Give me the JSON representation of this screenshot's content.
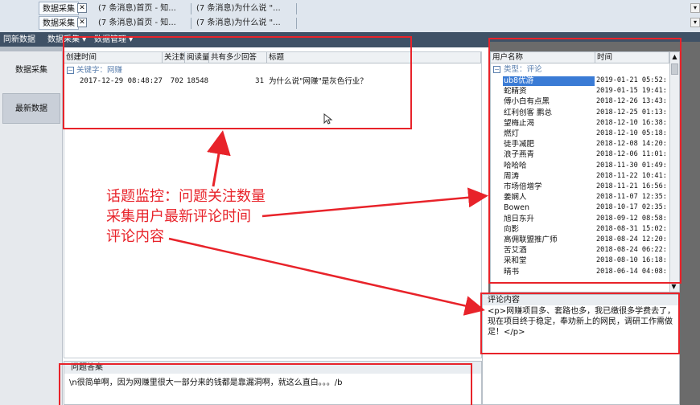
{
  "tabs": {
    "row1": {
      "active": "数据采集",
      "t1": "(7 条消息)首页 - 知...",
      "t2": "(7 条消息)为什么说 \"..."
    },
    "row2": {
      "active": "数据采集",
      "t1": "(7 条消息)首页 - 知...",
      "t2": "(7 条消息)为什么说 \"..."
    }
  },
  "menubar": {
    "item1": "同新数据",
    "item2": "数据采集 ▾",
    "item3": "数据管理 ▾"
  },
  "leftnav": {
    "btn1": "数据采集",
    "btn2": "最新数据"
  },
  "grid": {
    "headers": [
      "创建时间",
      "关注数",
      "阅读量",
      "共有多少回答",
      "标题"
    ],
    "group": "关键字：网赚",
    "rows": [
      {
        "created": "2017-12-29 08:48:27",
        "follow": "702",
        "read": "18548",
        "answers": "31",
        "title": "为什么说\"网赚\"是灰色行业？"
      }
    ]
  },
  "answer": {
    "title": "问题答案",
    "text": "\\n很简单啊，因为网赚里很大一部分来的钱都是靠漏洞啊，就这么直白。。。/b"
  },
  "userlist": {
    "headers": [
      "用户名称",
      "时间"
    ],
    "group": "类型：评论",
    "rows": [
      {
        "name": "ub8优游",
        "time": "2019-01-21 05:52:"
      },
      {
        "name": "蛇精资",
        "time": "2019-01-15 19:41:"
      },
      {
        "name": "傅小白有点黑",
        "time": "2018-12-26 13:43:"
      },
      {
        "name": "红利创客 鹏总",
        "time": "2018-12-25 01:13:"
      },
      {
        "name": "望梅止渴",
        "time": "2018-12-10 16:38:"
      },
      {
        "name": "燃灯",
        "time": "2018-12-10 05:18:"
      },
      {
        "name": "徒手减肥",
        "time": "2018-12-08 14:20:"
      },
      {
        "name": "浪子燕青",
        "time": "2018-12-06 11:01:"
      },
      {
        "name": "哈哈哈",
        "time": "2018-11-30 01:49:"
      },
      {
        "name": "周涛",
        "time": "2018-11-22 10:41:"
      },
      {
        "name": "市场倍增学",
        "time": "2018-11-21 16:56:"
      },
      {
        "name": "姜娴人",
        "time": "2018-11-07 12:35:"
      },
      {
        "name": "Bowen",
        "time": "2018-10-17 02:35:"
      },
      {
        "name": "旭日东升",
        "time": "2018-09-12 08:58:"
      },
      {
        "name": "向影",
        "time": "2018-08-31 15:02:"
      },
      {
        "name": "高佣联盟推广师",
        "time": "2018-08-24 12:20:"
      },
      {
        "name": "苦艾酒",
        "time": "2018-08-24 06:22:"
      },
      {
        "name": "采和堂",
        "time": "2018-08-10 16:18:"
      },
      {
        "name": "晴书",
        "time": "2018-06-14 04:08:"
      }
    ]
  },
  "comment": {
    "title": "评论内容",
    "text": "<p>网赚项目多、套路也多，我已缴很多学费去了，现在项目终于稳定，奉劝新上的网民，调研工作需做足！</p>"
  },
  "annotation": {
    "line1": "话题监控：问题关注数量",
    "line2": "采集用户最新评论时间",
    "line3": "评论内容"
  },
  "colors": {
    "annotation": "#e8232a",
    "menubar": "#3f5166",
    "selection": "#3a7bd5"
  }
}
